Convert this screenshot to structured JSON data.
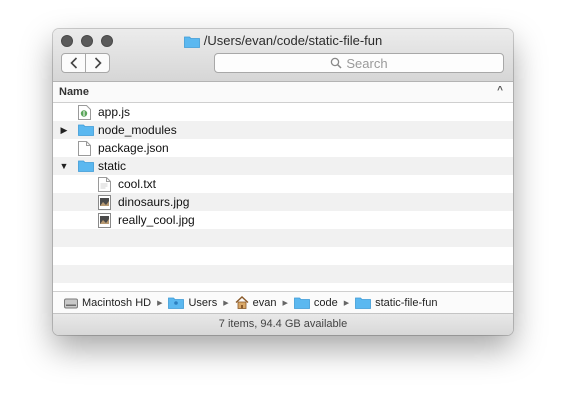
{
  "window": {
    "title": "/Users/evan/code/static-file-fun",
    "search_placeholder": "Search"
  },
  "columns": {
    "name": "Name"
  },
  "files": [
    {
      "name": "app.js",
      "icon": "js-file-icon",
      "indent": 0,
      "disclosure": ""
    },
    {
      "name": "node_modules",
      "icon": "folder-icon",
      "indent": 0,
      "disclosure": "collapsed"
    },
    {
      "name": "package.json",
      "icon": "document-icon",
      "indent": 0,
      "disclosure": ""
    },
    {
      "name": "static",
      "icon": "folder-icon",
      "indent": 0,
      "disclosure": "expanded"
    },
    {
      "name": "cool.txt",
      "icon": "text-file-icon",
      "indent": 1,
      "disclosure": ""
    },
    {
      "name": "dinosaurs.jpg",
      "icon": "image-file-icon",
      "indent": 1,
      "disclosure": ""
    },
    {
      "name": "really_cool.jpg",
      "icon": "image-file-icon",
      "indent": 1,
      "disclosure": ""
    }
  ],
  "pathbar": [
    {
      "label": "Macintosh HD",
      "icon": "hard-drive-icon"
    },
    {
      "label": "Users",
      "icon": "users-folder-icon"
    },
    {
      "label": "evan",
      "icon": "home-icon"
    },
    {
      "label": "code",
      "icon": "folder-icon"
    },
    {
      "label": "static-file-fun",
      "icon": "folder-icon"
    }
  ],
  "status": "7 items, 94.4 GB available",
  "colors": {
    "folder": "#5bb8f0",
    "row_alt": "#f1f1f1",
    "traffic_light": "#5a5a5a"
  }
}
